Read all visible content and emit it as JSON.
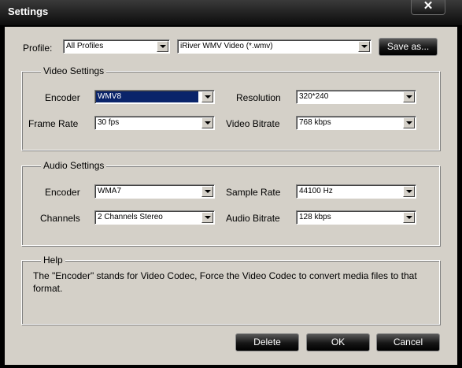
{
  "window": {
    "title": "Settings",
    "close_glyph": "✕"
  },
  "profile": {
    "label": "Profile:",
    "category": "All Profiles",
    "format": "iRiver WMV Video (*.wmv)",
    "save_as": "Save as..."
  },
  "video": {
    "legend": "Video Settings",
    "encoder_label": "Encoder",
    "encoder": "WMV8",
    "resolution_label": "Resolution",
    "resolution": "320*240",
    "frame_rate_label": "Frame Rate",
    "frame_rate": "30 fps",
    "bitrate_label": "Video Bitrate",
    "bitrate": "768 kbps"
  },
  "audio": {
    "legend": "Audio Settings",
    "encoder_label": "Encoder",
    "encoder": "WMA7",
    "sample_rate_label": "Sample Rate",
    "sample_rate": "44100 Hz",
    "channels_label": "Channels",
    "channels": "2 Channels Stereo",
    "bitrate_label": "Audio Bitrate",
    "bitrate": "128 kbps"
  },
  "help": {
    "legend": "Help",
    "text": "The \"Encoder\" stands for Video Codec, Force the Video Codec to convert media files to that format."
  },
  "buttons": {
    "delete": "Delete",
    "ok": "OK",
    "cancel": "Cancel"
  }
}
